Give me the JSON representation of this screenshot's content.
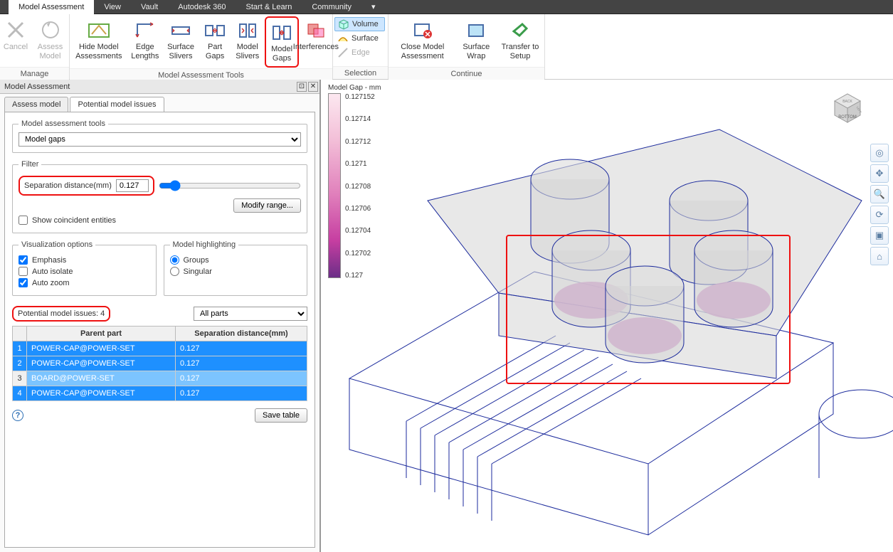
{
  "menu": {
    "items": [
      "Model Assessment",
      "View",
      "Vault",
      "Autodesk 360",
      "Start & Learn",
      "Community"
    ],
    "active_index": 0
  },
  "ribbon": {
    "manage": {
      "label": "Manage",
      "cancel": "Cancel",
      "assess": "Assess Model"
    },
    "tools": {
      "label": "Model Assessment Tools",
      "hide": "Hide Model Assessments",
      "edge": "Edge Lengths",
      "surface_slivers": "Surface Slivers",
      "part_gaps": "Part Gaps",
      "model_slivers": "Model Slivers",
      "model_gaps": "Model Gaps",
      "interferences": "Interferences"
    },
    "selection": {
      "label": "Selection",
      "volume": "Volume",
      "surface": "Surface",
      "edge": "Edge"
    },
    "continue": {
      "label": "Continue",
      "close": "Close Model Assessment",
      "wrap": "Surface Wrap",
      "transfer": "Transfer to Setup"
    }
  },
  "panel": {
    "title": "Model Assessment",
    "tabs": {
      "assess": "Assess model",
      "issues": "Potential model issues"
    },
    "tools_label": "Model assessment tools",
    "tools_value": "Model gaps",
    "filter": {
      "legend": "Filter",
      "sep_label": "Separation distance(mm)",
      "sep_value": "0.127",
      "modify": "Modify range...",
      "coincident": "Show coincident entities"
    },
    "vis": {
      "legend": "Visualization options",
      "emphasis": "Emphasis",
      "auto_isolate": "Auto isolate",
      "auto_zoom": "Auto zoom"
    },
    "highlight": {
      "legend": "Model highlighting",
      "groups": "Groups",
      "singular": "Singular"
    },
    "issues_label": "Potential model issues:  4",
    "parts_value": "All parts",
    "table": {
      "col_num": "",
      "col_parent": "Parent part",
      "col_sep": "Separation distance(mm)",
      "rows": [
        {
          "n": "1",
          "parent": "POWER-CAP@POWER-SET",
          "sep": "0.127",
          "cls": "sel-strong"
        },
        {
          "n": "2",
          "parent": "POWER-CAP@POWER-SET",
          "sep": "0.127",
          "cls": "sel-strong"
        },
        {
          "n": "3",
          "parent": "BOARD@POWER-SET",
          "sep": "0.127",
          "cls": "sel-light"
        },
        {
          "n": "4",
          "parent": "POWER-CAP@POWER-SET",
          "sep": "0.127",
          "cls": "sel-strong"
        }
      ]
    },
    "save": "Save table"
  },
  "legend": {
    "title": "Model Gap - mm",
    "ticks": [
      "0.127152",
      "0.12714",
      "0.12712",
      "0.1271",
      "0.12708",
      "0.12706",
      "0.12704",
      "0.12702",
      "0.127"
    ]
  },
  "viewcube": {
    "face": "BOTTOM",
    "top": "BACK",
    "side": "LEFT"
  }
}
